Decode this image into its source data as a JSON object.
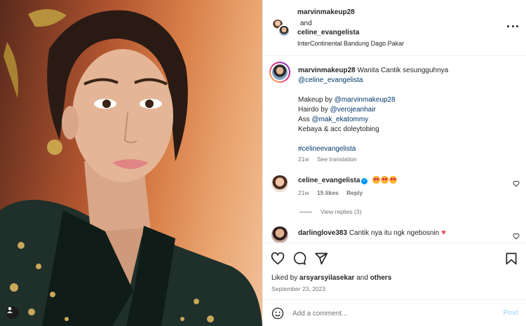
{
  "header": {
    "user1": "marvinmakeup28",
    "and_text": "and",
    "user2": "celine_evangelista",
    "location": "InterContinental Bandung Dago Pakar"
  },
  "caption": {
    "username": "marvinmakeup28",
    "line1_text": "Wanita Cantik sesungguhnya",
    "line1_mention": "@celine_evangelista",
    "makeup_label": "Makeup by",
    "makeup_mention": "@marvinmakeup28",
    "hairdo_label": "Hairdo by",
    "hairdo_mention": "@verojeanhair",
    "ass_label": "Ass",
    "ass_mention": "@mak_ekatommy",
    "kebaya_text": "Kebaya & acc doleytobing",
    "hashtag": "#celineevangelista",
    "age": "21w",
    "see_translation": "See translation"
  },
  "comments": [
    {
      "username": "celine_evangelista",
      "age": "21w",
      "likes": "15 likes",
      "reply": "Reply",
      "view_replies": "View replies (3)"
    },
    {
      "username": "darlinglove383",
      "text": "Cantik nya itu ngk ngebosnin"
    }
  ],
  "footer": {
    "liked_by_prefix": "Liked by",
    "liked_by_user": "arsyarsyilasekar",
    "liked_by_and": "and",
    "liked_by_others": "others",
    "date": "September 23, 2023",
    "comment_placeholder": "Add a comment...",
    "post_label": "Post"
  },
  "colors": {
    "link": "#00376b",
    "verified": "#0095f6",
    "post_disabled": "#b2dffc",
    "heart": "#ed4956",
    "muted": "#737373"
  },
  "icons": [
    "more-options-icon",
    "verified-icon",
    "heart-eyes-emoji",
    "red-heart-emoji",
    "like-icon",
    "comment-icon",
    "share-icon",
    "save-icon",
    "emoji-picker-icon",
    "tagged-user-icon"
  ]
}
